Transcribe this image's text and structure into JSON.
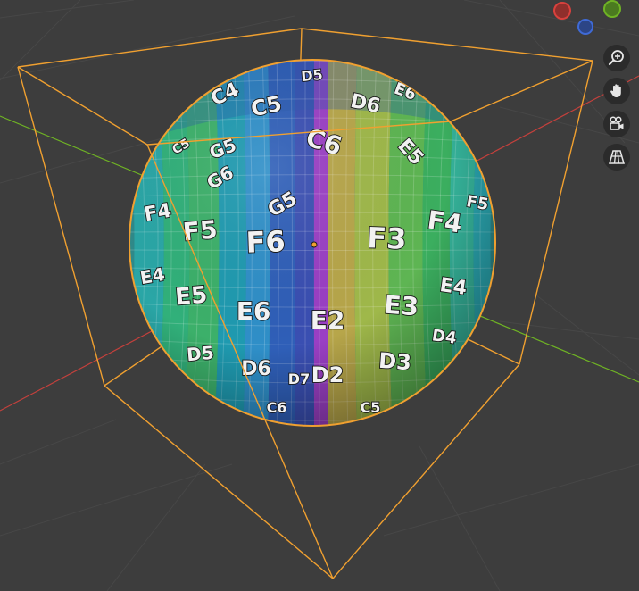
{
  "viewport": {
    "background": "#3d3d3d"
  },
  "gizmo": {
    "x_axis": {
      "name": "X",
      "color": "#d9413d"
    },
    "y_axis": {
      "name": "Y",
      "color": "#6fb324"
    },
    "z_axis": {
      "name": "Z",
      "color": "#3f6ad6"
    }
  },
  "navigation": [
    {
      "name": "zoom",
      "icon": "zoom-in-icon"
    },
    {
      "name": "pan",
      "icon": "hand-icon"
    },
    {
      "name": "camera",
      "icon": "camera-icon"
    },
    {
      "name": "perspective-toggle",
      "icon": "grid-icon"
    }
  ],
  "object": {
    "type": "uv-sphere",
    "selected": true,
    "bounds_color": "#f0a030",
    "texture": "uv-checker-grid"
  },
  "tile_labels": [
    "C4",
    "C5",
    "D5",
    "D6",
    "E6",
    "C6",
    "G5",
    "G6",
    "G5",
    "C5",
    "E5",
    "F4",
    "F5",
    "F6",
    "F3",
    "F4",
    "F5",
    "E4",
    "E5",
    "E6",
    "E2",
    "E3",
    "E4",
    "D5",
    "D6",
    "D2",
    "D3",
    "D4",
    "C6",
    "C5",
    "D7"
  ]
}
